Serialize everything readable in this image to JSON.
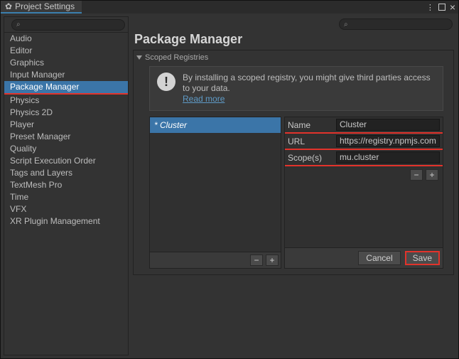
{
  "titlebar": {
    "tab_label": "Project Settings",
    "menu_icon": "⋮",
    "restore_icon": "□",
    "close_icon": "×"
  },
  "sidebar": {
    "search_placeholder": "",
    "items": [
      {
        "label": "Audio"
      },
      {
        "label": "Editor"
      },
      {
        "label": "Graphics"
      },
      {
        "label": "Input Manager"
      },
      {
        "label": "Package Manager",
        "selected": true
      },
      {
        "label": "Physics"
      },
      {
        "label": "Physics 2D"
      },
      {
        "label": "Player"
      },
      {
        "label": "Preset Manager"
      },
      {
        "label": "Quality"
      },
      {
        "label": "Script Execution Order"
      },
      {
        "label": "Tags and Layers"
      },
      {
        "label": "TextMesh Pro"
      },
      {
        "label": "Time"
      },
      {
        "label": "VFX"
      },
      {
        "label": "XR Plugin Management"
      }
    ]
  },
  "main": {
    "title": "Package Manager",
    "section_label": "Scoped Registries",
    "info_text": "By installing a scoped registry, you might give third parties access to your data.",
    "read_more": "Read more",
    "registry_list": [
      "* Cluster"
    ],
    "minus": "−",
    "plus": "+",
    "form": {
      "name_label": "Name",
      "name_value": "Cluster",
      "url_label": "URL",
      "url_value": "https://registry.npmjs.com",
      "scopes_label": "Scope(s)",
      "scopes_value": "mu.cluster"
    },
    "cancel": "Cancel",
    "save": "Save"
  }
}
